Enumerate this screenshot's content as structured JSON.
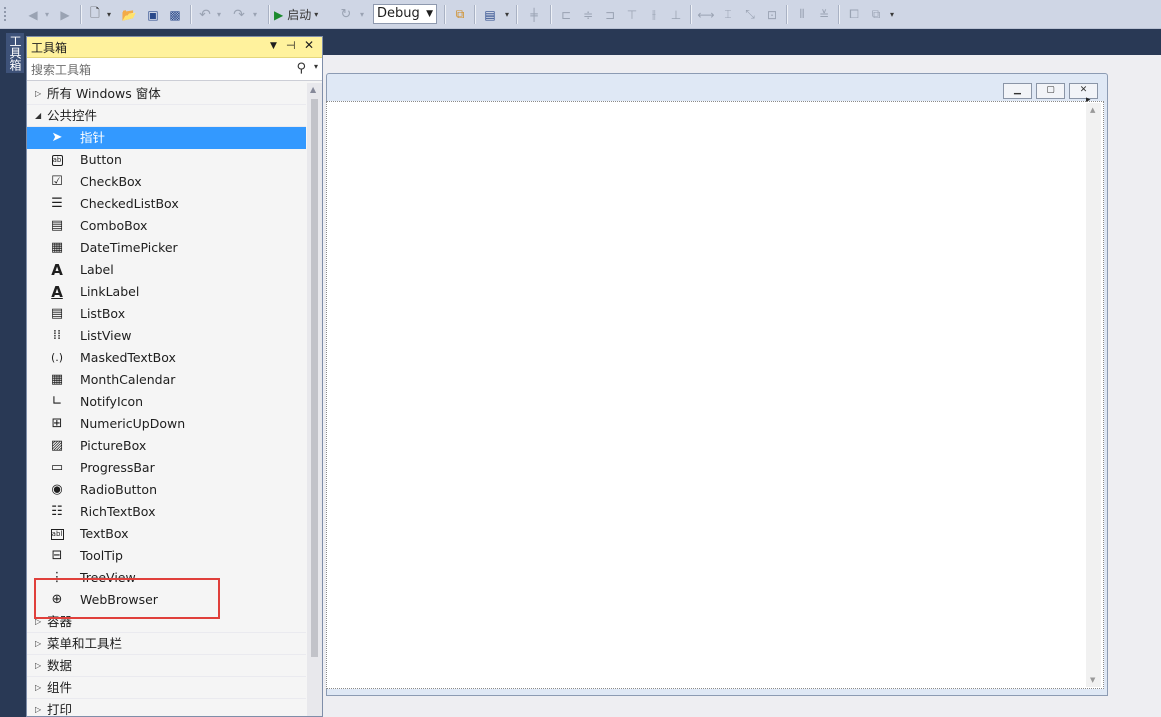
{
  "toolbar": {
    "start_label": "启动",
    "config_value": "Debug"
  },
  "left_tab": {
    "label": "工具箱"
  },
  "toolbox": {
    "title": "工具箱",
    "search_placeholder": "搜索工具箱",
    "categories_top": [
      {
        "label": "所有 Windows 窗体",
        "expanded": false
      },
      {
        "label": "公共控件",
        "expanded": true
      }
    ],
    "items": [
      {
        "label": "指针",
        "icon": "pointer-icon",
        "selected": true
      },
      {
        "label": "Button",
        "icon": "button-icon"
      },
      {
        "label": "CheckBox",
        "icon": "checkbox-icon"
      },
      {
        "label": "CheckedListBox",
        "icon": "checkedlistbox-icon"
      },
      {
        "label": "ComboBox",
        "icon": "combobox-icon"
      },
      {
        "label": "DateTimePicker",
        "icon": "datetimepicker-icon"
      },
      {
        "label": "Label",
        "icon": "label-icon"
      },
      {
        "label": "LinkLabel",
        "icon": "linklabel-icon"
      },
      {
        "label": "ListBox",
        "icon": "listbox-icon"
      },
      {
        "label": "ListView",
        "icon": "listview-icon"
      },
      {
        "label": "MaskedTextBox",
        "icon": "maskedtextbox-icon"
      },
      {
        "label": "MonthCalendar",
        "icon": "monthcalendar-icon"
      },
      {
        "label": "NotifyIcon",
        "icon": "notifyicon-icon"
      },
      {
        "label": "NumericUpDown",
        "icon": "numericupdown-icon"
      },
      {
        "label": "PictureBox",
        "icon": "picturebox-icon"
      },
      {
        "label": "ProgressBar",
        "icon": "progressbar-icon"
      },
      {
        "label": "RadioButton",
        "icon": "radiobutton-icon"
      },
      {
        "label": "RichTextBox",
        "icon": "richtextbox-icon"
      },
      {
        "label": "TextBox",
        "icon": "textbox-icon"
      },
      {
        "label": "ToolTip",
        "icon": "tooltip-icon"
      },
      {
        "label": "TreeView",
        "icon": "treeview-icon"
      },
      {
        "label": "WebBrowser",
        "icon": "webbrowser-icon"
      }
    ],
    "categories_bottom": [
      {
        "label": "容器",
        "expanded": false
      },
      {
        "label": "菜单和工具栏",
        "expanded": false
      },
      {
        "label": "数据",
        "expanded": false
      },
      {
        "label": "组件",
        "expanded": false
      },
      {
        "label": "打印",
        "expanded": false
      }
    ]
  },
  "colors": {
    "selection": "#3399ff",
    "title_bar": "#fff29d",
    "highlight_box": "#e0403b"
  }
}
